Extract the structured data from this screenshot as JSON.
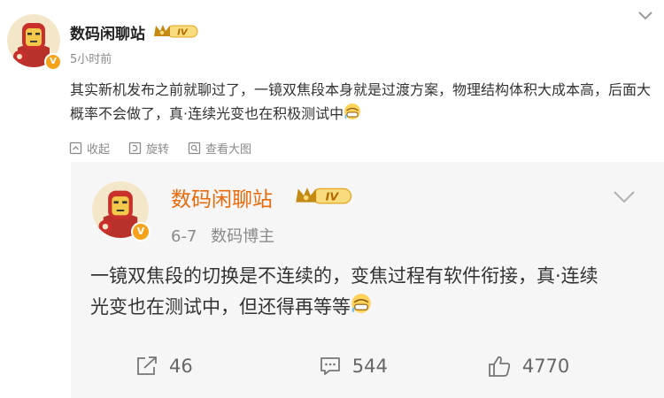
{
  "post": {
    "author": "数码闲聊站",
    "vip_level": "IV",
    "time": "5小时前",
    "text": "其实新机发布之前就聊过了，一镜双焦段本身就是过渡方案，物理结构体积大成本高，后面大概率不会做了，真·连续光变也在积极测试中",
    "actions": {
      "favorite": "收起",
      "repost": "旋转",
      "view_large": "查看大图"
    }
  },
  "repost": {
    "author": "数码闲聊站",
    "vip_level": "IV",
    "date": "6-7",
    "source": "数码博主",
    "text": "一镜双焦段的切换是不连续的，变焦过程有软件衔接，真·连续光变也在测试中，但还得再等等",
    "stats": {
      "share": "46",
      "comment": "544",
      "like": "4770"
    }
  },
  "colors": {
    "accent_orange": "#e96a0a",
    "badge_gold": "#f7a21b",
    "meta_gray": "#8a8a8a"
  },
  "icons": [
    "ironman-avatar",
    "verified-v-icon",
    "vip-crown-icon",
    "chevron-down-icon",
    "collapse-icon",
    "rotate-icon",
    "zoom-icon",
    "share-icon",
    "comment-icon",
    "like-icon",
    "grin-emoji-icon"
  ]
}
